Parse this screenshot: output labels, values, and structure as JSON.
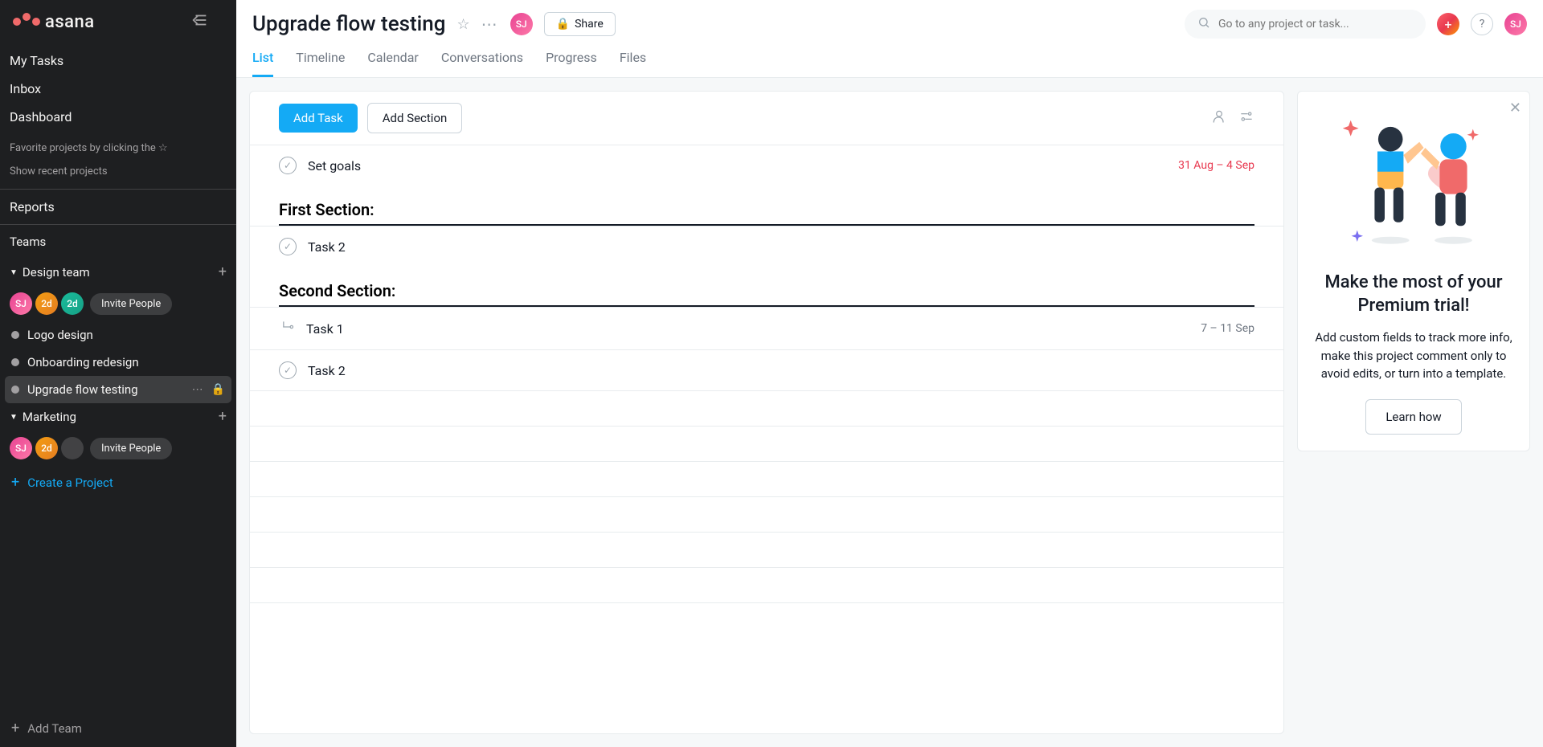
{
  "brand": {
    "name": "asana"
  },
  "sidebar": {
    "nav": {
      "my_tasks": "My Tasks",
      "inbox": "Inbox",
      "dashboard": "Dashboard"
    },
    "fav_hint": "Favorite projects by clicking the",
    "show_recent": "Show recent projects",
    "reports": "Reports",
    "teams_label": "Teams",
    "teams": [
      {
        "name": "Design team",
        "avatars": [
          "SJ",
          "2d",
          "2d"
        ],
        "invite": "Invite People",
        "projects": [
          {
            "name": "Logo design",
            "active": false,
            "private": false
          },
          {
            "name": "Onboarding redesign",
            "active": false,
            "private": false
          },
          {
            "name": "Upgrade flow testing",
            "active": true,
            "private": true
          }
        ]
      },
      {
        "name": "Marketing",
        "avatars": [
          "SJ",
          "2d"
        ],
        "invite": "Invite People",
        "projects": []
      }
    ],
    "create_project": "Create a Project",
    "add_team": "Add Team"
  },
  "header": {
    "title": "Upgrade flow testing",
    "share": "Share",
    "avatar": "SJ",
    "search_placeholder": "Go to any project or task...",
    "help": "?",
    "user_avatar": "SJ"
  },
  "tabs": [
    "List",
    "Timeline",
    "Calendar",
    "Conversations",
    "Progress",
    "Files"
  ],
  "active_tab": 0,
  "toolbar": {
    "add_task": "Add Task",
    "add_section": "Add Section"
  },
  "tasks": {
    "ungrouped": [
      {
        "name": "Set goals",
        "date": "31 Aug – 4 Sep",
        "overdue": true
      }
    ],
    "sections": [
      {
        "title": "First Section:",
        "tasks": [
          {
            "name": "Task 2",
            "date": "",
            "subtask": false
          }
        ]
      },
      {
        "title": "Second Section:",
        "tasks": [
          {
            "name": "Task 1",
            "date": "7 – 11 Sep",
            "subtask": true
          },
          {
            "name": "Task 2",
            "date": "",
            "subtask": false
          }
        ]
      }
    ]
  },
  "promo": {
    "title": "Make the most of your Premium trial!",
    "text": "Add custom fields to track more info, make this project comment only to avoid edits, or turn into a template.",
    "cta": "Learn how"
  },
  "colors": {
    "accent": "#14aaf5",
    "danger": "#e8384f"
  }
}
